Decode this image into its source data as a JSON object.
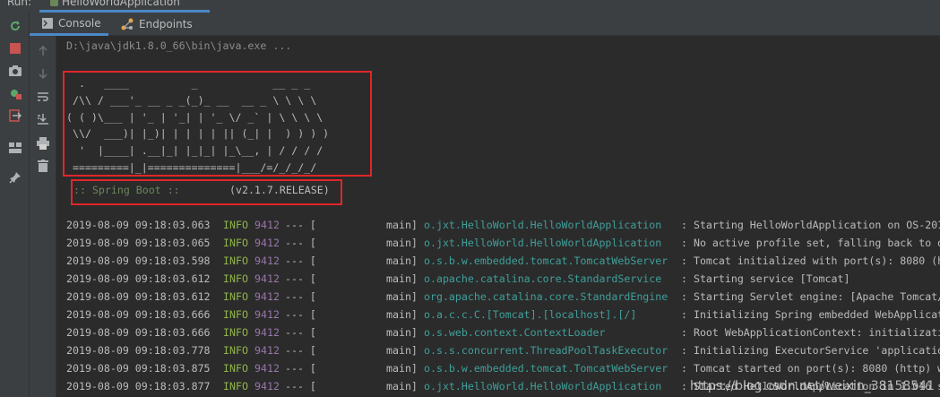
{
  "run_bar": {
    "label": "Run:",
    "tab_label": "HelloWorldApplication"
  },
  "tabs": [
    {
      "label": "Console",
      "icon": "console-icon",
      "active": true
    },
    {
      "label": "Endpoints",
      "icon": "endpoints-icon",
      "active": false
    }
  ],
  "left_toolbar": [
    "rerun-icon",
    "stop-icon",
    "camera-icon",
    "debug-settings-icon",
    "exit-icon",
    "layout-icon",
    "pin-icon"
  ],
  "console_toolbar": [
    "up-arrow-icon",
    "down-arrow-icon",
    "soft-wrap-icon",
    "scroll-to-end-icon",
    "print-icon",
    "trash-icon"
  ],
  "console": {
    "command_line": "D:\\java\\jdk1.8.0_66\\bin\\java.exe ...",
    "banner": "  .   ____          _            __ _ _\n /\\\\ / ___'_ __ _ _(_)_ __  __ _ \\ \\ \\ \\\n( ( )\\___ | '_ | '_| | '_ \\/ _` | \\ \\ \\ \\\n \\\\/  ___)| |_)| | | | | || (_| |  ) ) ) )\n  '  |____| .__|_| |_|_| |_\\__, | / / / /\n =========|_|==============|___/=/_/_/_/",
    "spring_boot_label": ":: Spring Boot ::",
    "spring_boot_version": "(v2.1.7.RELEASE)",
    "log": [
      {
        "date": "2019-08-09 09:18:03.063",
        "level": "INFO",
        "pid": "9412",
        "sep": "--- [",
        "thread": "main]",
        "logger": "o.jxt.HelloWorld.HelloWorldApplication",
        "msg": ": Starting HelloWorldApplication on OS-201"
      },
      {
        "date": "2019-08-09 09:18:03.065",
        "level": "INFO",
        "pid": "9412",
        "sep": "--- [",
        "thread": "main]",
        "logger": "o.jxt.HelloWorld.HelloWorldApplication",
        "msg": ": No active profile set, falling back to d"
      },
      {
        "date": "2019-08-09 09:18:03.598",
        "level": "INFO",
        "pid": "9412",
        "sep": "--- [",
        "thread": "main]",
        "logger": "o.s.b.w.embedded.tomcat.TomcatWebServer",
        "msg": ": Tomcat initialized with port(s): 8080 (h"
      },
      {
        "date": "2019-08-09 09:18:03.612",
        "level": "INFO",
        "pid": "9412",
        "sep": "--- [",
        "thread": "main]",
        "logger": "o.apache.catalina.core.StandardService",
        "msg": ": Starting service [Tomcat]"
      },
      {
        "date": "2019-08-09 09:18:03.612",
        "level": "INFO",
        "pid": "9412",
        "sep": "--- [",
        "thread": "main]",
        "logger": "org.apache.catalina.core.StandardEngine",
        "msg": ": Starting Servlet engine: [Apache Tomcat/"
      },
      {
        "date": "2019-08-09 09:18:03.666",
        "level": "INFO",
        "pid": "9412",
        "sep": "--- [",
        "thread": "main]",
        "logger": "o.a.c.c.C.[Tomcat].[localhost].[/]",
        "msg": ": Initializing Spring embedded WebApplicat"
      },
      {
        "date": "2019-08-09 09:18:03.666",
        "level": "INFO",
        "pid": "9412",
        "sep": "--- [",
        "thread": "main]",
        "logger": "o.s.web.context.ContextLoader",
        "msg": ": Root WebApplicationContext: initializati"
      },
      {
        "date": "2019-08-09 09:18:03.778",
        "level": "INFO",
        "pid": "9412",
        "sep": "--- [",
        "thread": "main]",
        "logger": "o.s.s.concurrent.ThreadPoolTaskExecutor",
        "msg": ": Initializing ExecutorService 'applicatio"
      },
      {
        "date": "2019-08-09 09:18:03.875",
        "level": "INFO",
        "pid": "9412",
        "sep": "--- [",
        "thread": "main]",
        "logger": "o.s.b.w.embedded.tomcat.TomcatWebServer",
        "msg": ": Tomcat started on port(s): 8080 (http) w"
      },
      {
        "date": "2019-08-09 09:18:03.877",
        "level": "INFO",
        "pid": "9412",
        "sep": "--- [",
        "thread": "main]",
        "logger": "o.jxt.HelloWorld.HelloWorldApplication",
        "msg": ": Started HelloWorldApplication in 1.016 s"
      }
    ]
  },
  "watermark": "https://blog.csdn.net/weixin_38158541",
  "colors": {
    "background": "#2b2b2b",
    "toolbar": "#3c3f41",
    "info": "#8fb34b",
    "pid": "#9876aa",
    "logger": "#3f9f9a",
    "spring_boot_label": "#6a8759",
    "highlight_box": "#e0262a",
    "active_tab_underline": "#4a88c7"
  }
}
